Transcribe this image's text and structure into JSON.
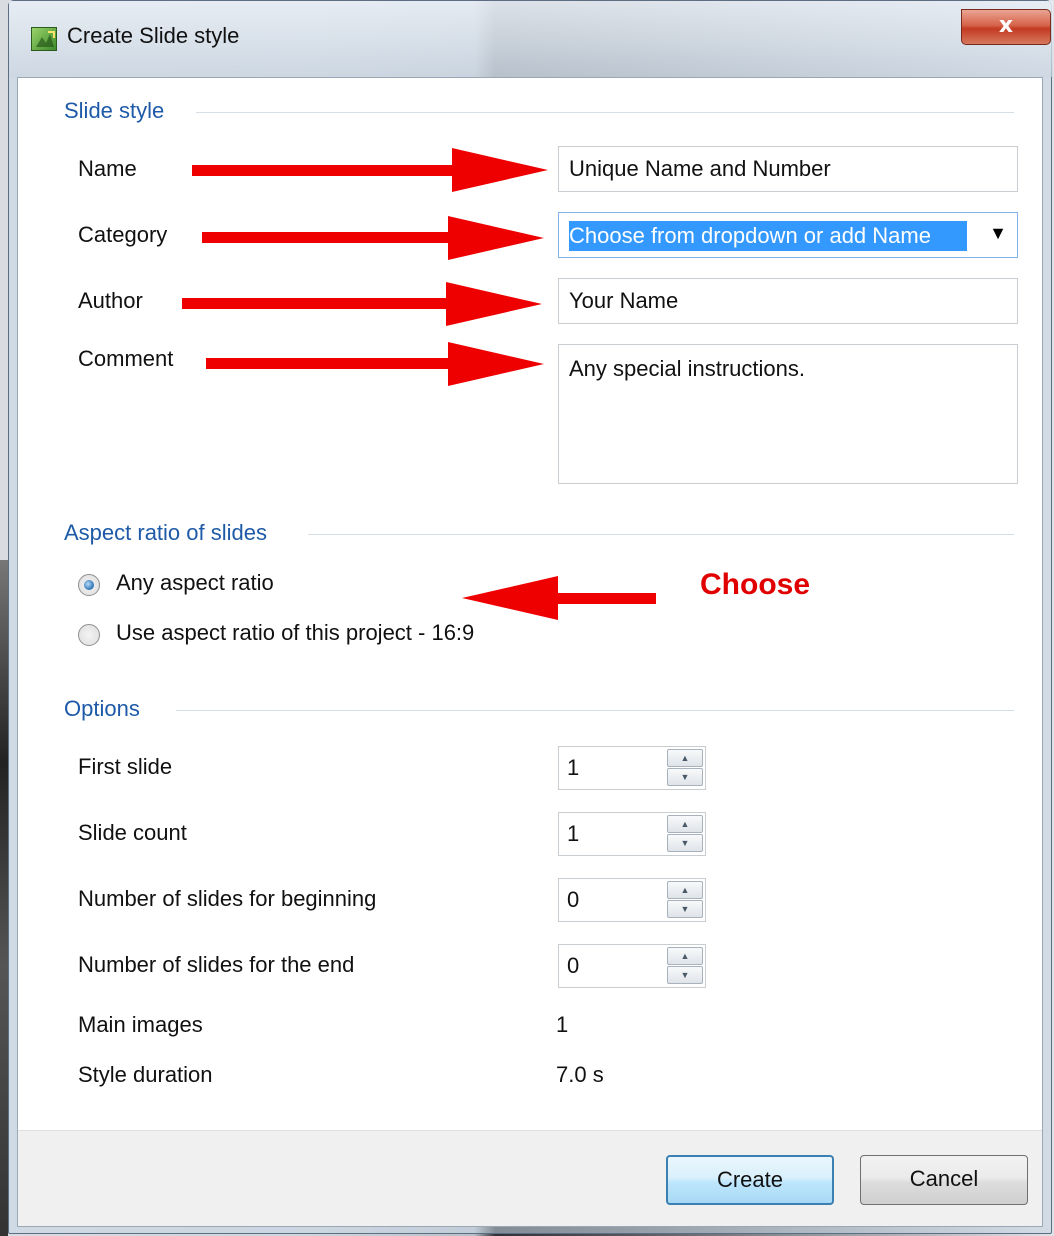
{
  "window": {
    "title": "Create Slide style",
    "close_label": "x"
  },
  "slide_style": {
    "group_title": "Slide style",
    "name_label": "Name",
    "name_value": "Unique Name and Number",
    "category_label": "Category",
    "category_value": "Choose from dropdown or add Name",
    "author_label": "Author",
    "author_value": "Your Name",
    "comment_label": "Comment",
    "comment_value": "Any special instructions."
  },
  "aspect": {
    "group_title": "Aspect ratio of slides",
    "option_any": "Any aspect ratio",
    "option_project": "Use aspect ratio of this project - 16:9",
    "selected": "any",
    "annotation": "Choose"
  },
  "options": {
    "group_title": "Options",
    "first_slide_label": "First slide",
    "first_slide_value": "1",
    "slide_count_label": "Slide count",
    "slide_count_value": "1",
    "beginning_label": "Number of slides for beginning",
    "beginning_value": "0",
    "end_label": "Number of slides for the end",
    "end_value": "0",
    "main_images_label": "Main images",
    "main_images_value": "1",
    "duration_label": "Style duration",
    "duration_value": "7.0 s"
  },
  "buttons": {
    "create_label": "Create",
    "cancel_label": "Cancel"
  },
  "icons": {
    "spin_up": "▲",
    "spin_down": "▼",
    "combo_arrow": "▼"
  },
  "colors": {
    "annotation_red": "#ee0000",
    "group_title_blue": "#1e5aa8",
    "selection_blue": "#3399ff"
  }
}
